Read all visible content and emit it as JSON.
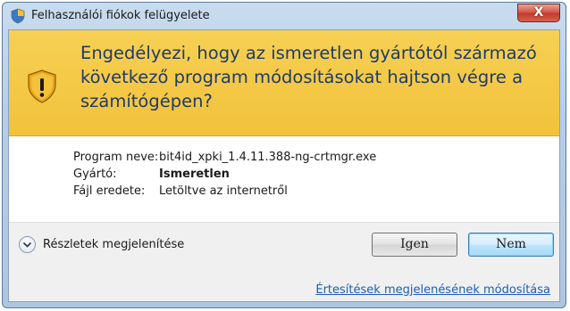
{
  "window": {
    "title": "Felhasználói fiókok felügyelete",
    "close_glyph": "X"
  },
  "banner": {
    "icon": "uac-warning-shield-icon",
    "line1": "Engedélyezi, hogy az ismeretlen gyártótól származó",
    "line2": "következő program módosításokat hajtson végre a",
    "line3": "számítógépen?"
  },
  "details": {
    "program_label": "Program neve:",
    "program_value": "bit4id_xpki_1.4.11.388-ng-crtmgr.exe",
    "publisher_label": "Gyártó:",
    "publisher_value": "Ismeretlen",
    "origin_label": "Fájl eredete:",
    "origin_value": "Letöltve az internetről"
  },
  "footer": {
    "show_details_label": "Részletek megjelenítése",
    "yes_button": "Igen",
    "no_button": "Nem",
    "change_notifications_link": "Értesítések megjelenésének módosítása"
  },
  "colors": {
    "banner_yellow": "#f2c23a",
    "heading_blue": "#1e3b6b",
    "link_blue": "#1a5fb4",
    "close_red": "#c23b2c"
  }
}
